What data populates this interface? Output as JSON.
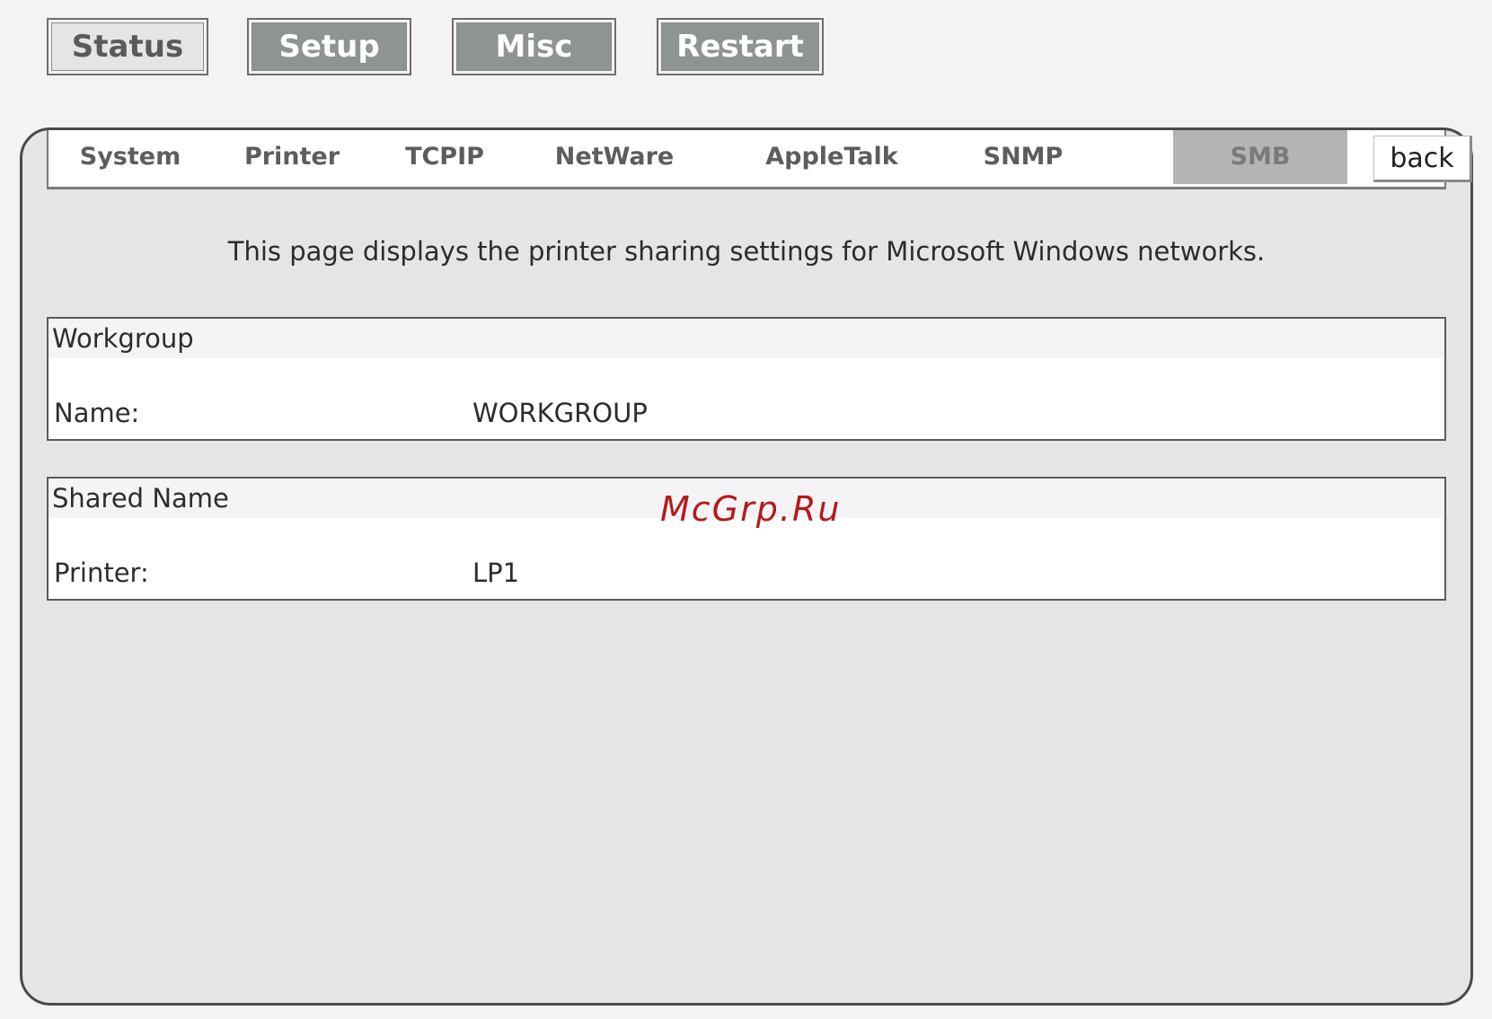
{
  "top_nav": {
    "status": "Status",
    "setup": "Setup",
    "misc": "Misc",
    "restart": "Restart"
  },
  "tabs": {
    "system": "System",
    "printer": "Printer",
    "tcpip": "TCPIP",
    "netware": "NetWare",
    "appletalk": "AppleTalk",
    "snmp": "SNMP",
    "smb": "SMB",
    "active": "SMB",
    "back": "back"
  },
  "description": "This page displays the printer sharing settings for Microsoft Windows networks.",
  "workgroup": {
    "header": "Workgroup",
    "label": "Name:",
    "value": "WORKGROUP"
  },
  "shared_name": {
    "header": "Shared Name",
    "label": "Printer:",
    "value": "LP1"
  },
  "watermark": "McGrp.Ru",
  "colors": {
    "active_nav": "#8d9491",
    "active_tab": "#b4b4b4",
    "panel_bg": "#e7e4e7",
    "watermark": "#b51a1a"
  }
}
